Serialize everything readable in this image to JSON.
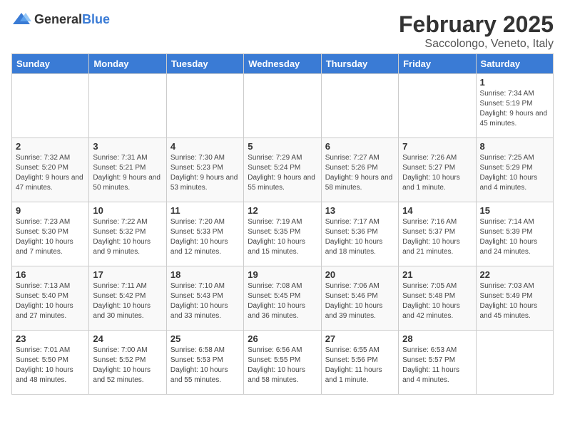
{
  "header": {
    "logo_general": "General",
    "logo_blue": "Blue",
    "title": "February 2025",
    "subtitle": "Saccolongo, Veneto, Italy"
  },
  "days_of_week": [
    "Sunday",
    "Monday",
    "Tuesday",
    "Wednesday",
    "Thursday",
    "Friday",
    "Saturday"
  ],
  "weeks": [
    [
      {
        "day": "",
        "info": ""
      },
      {
        "day": "",
        "info": ""
      },
      {
        "day": "",
        "info": ""
      },
      {
        "day": "",
        "info": ""
      },
      {
        "day": "",
        "info": ""
      },
      {
        "day": "",
        "info": ""
      },
      {
        "day": "1",
        "info": "Sunrise: 7:34 AM\nSunset: 5:19 PM\nDaylight: 9 hours and 45 minutes."
      }
    ],
    [
      {
        "day": "2",
        "info": "Sunrise: 7:32 AM\nSunset: 5:20 PM\nDaylight: 9 hours and 47 minutes."
      },
      {
        "day": "3",
        "info": "Sunrise: 7:31 AM\nSunset: 5:21 PM\nDaylight: 9 hours and 50 minutes."
      },
      {
        "day": "4",
        "info": "Sunrise: 7:30 AM\nSunset: 5:23 PM\nDaylight: 9 hours and 53 minutes."
      },
      {
        "day": "5",
        "info": "Sunrise: 7:29 AM\nSunset: 5:24 PM\nDaylight: 9 hours and 55 minutes."
      },
      {
        "day": "6",
        "info": "Sunrise: 7:27 AM\nSunset: 5:26 PM\nDaylight: 9 hours and 58 minutes."
      },
      {
        "day": "7",
        "info": "Sunrise: 7:26 AM\nSunset: 5:27 PM\nDaylight: 10 hours and 1 minute."
      },
      {
        "day": "8",
        "info": "Sunrise: 7:25 AM\nSunset: 5:29 PM\nDaylight: 10 hours and 4 minutes."
      }
    ],
    [
      {
        "day": "9",
        "info": "Sunrise: 7:23 AM\nSunset: 5:30 PM\nDaylight: 10 hours and 7 minutes."
      },
      {
        "day": "10",
        "info": "Sunrise: 7:22 AM\nSunset: 5:32 PM\nDaylight: 10 hours and 9 minutes."
      },
      {
        "day": "11",
        "info": "Sunrise: 7:20 AM\nSunset: 5:33 PM\nDaylight: 10 hours and 12 minutes."
      },
      {
        "day": "12",
        "info": "Sunrise: 7:19 AM\nSunset: 5:35 PM\nDaylight: 10 hours and 15 minutes."
      },
      {
        "day": "13",
        "info": "Sunrise: 7:17 AM\nSunset: 5:36 PM\nDaylight: 10 hours and 18 minutes."
      },
      {
        "day": "14",
        "info": "Sunrise: 7:16 AM\nSunset: 5:37 PM\nDaylight: 10 hours and 21 minutes."
      },
      {
        "day": "15",
        "info": "Sunrise: 7:14 AM\nSunset: 5:39 PM\nDaylight: 10 hours and 24 minutes."
      }
    ],
    [
      {
        "day": "16",
        "info": "Sunrise: 7:13 AM\nSunset: 5:40 PM\nDaylight: 10 hours and 27 minutes."
      },
      {
        "day": "17",
        "info": "Sunrise: 7:11 AM\nSunset: 5:42 PM\nDaylight: 10 hours and 30 minutes."
      },
      {
        "day": "18",
        "info": "Sunrise: 7:10 AM\nSunset: 5:43 PM\nDaylight: 10 hours and 33 minutes."
      },
      {
        "day": "19",
        "info": "Sunrise: 7:08 AM\nSunset: 5:45 PM\nDaylight: 10 hours and 36 minutes."
      },
      {
        "day": "20",
        "info": "Sunrise: 7:06 AM\nSunset: 5:46 PM\nDaylight: 10 hours and 39 minutes."
      },
      {
        "day": "21",
        "info": "Sunrise: 7:05 AM\nSunset: 5:48 PM\nDaylight: 10 hours and 42 minutes."
      },
      {
        "day": "22",
        "info": "Sunrise: 7:03 AM\nSunset: 5:49 PM\nDaylight: 10 hours and 45 minutes."
      }
    ],
    [
      {
        "day": "23",
        "info": "Sunrise: 7:01 AM\nSunset: 5:50 PM\nDaylight: 10 hours and 48 minutes."
      },
      {
        "day": "24",
        "info": "Sunrise: 7:00 AM\nSunset: 5:52 PM\nDaylight: 10 hours and 52 minutes."
      },
      {
        "day": "25",
        "info": "Sunrise: 6:58 AM\nSunset: 5:53 PM\nDaylight: 10 hours and 55 minutes."
      },
      {
        "day": "26",
        "info": "Sunrise: 6:56 AM\nSunset: 5:55 PM\nDaylight: 10 hours and 58 minutes."
      },
      {
        "day": "27",
        "info": "Sunrise: 6:55 AM\nSunset: 5:56 PM\nDaylight: 11 hours and 1 minute."
      },
      {
        "day": "28",
        "info": "Sunrise: 6:53 AM\nSunset: 5:57 PM\nDaylight: 11 hours and 4 minutes."
      },
      {
        "day": "",
        "info": ""
      }
    ]
  ]
}
